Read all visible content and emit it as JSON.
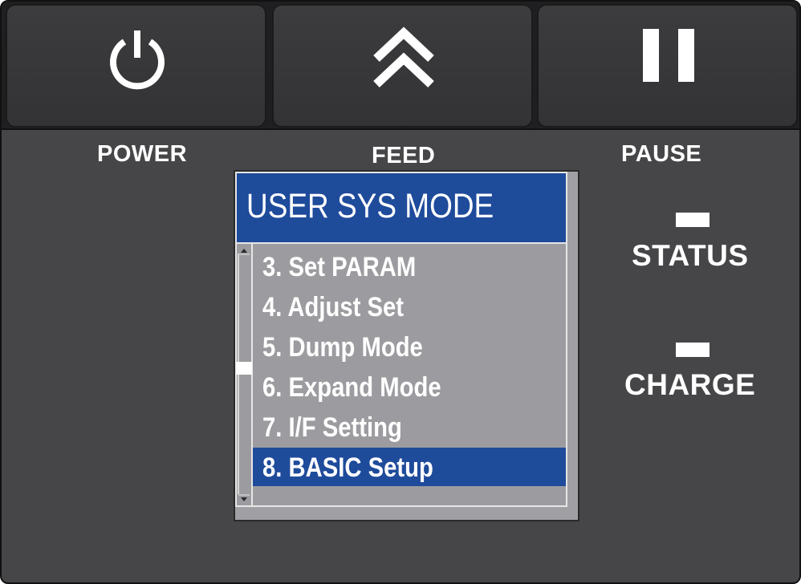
{
  "buttons": {
    "power": {
      "label": "POWER",
      "icon": "power-icon"
    },
    "feed": {
      "label": "FEED",
      "icon": "double-chevron-up-icon"
    },
    "pause": {
      "label": "PAUSE",
      "icon": "pause-icon"
    }
  },
  "lcd": {
    "title": "USER SYS MODE",
    "items": [
      {
        "label": "3. Set PARAM"
      },
      {
        "label": "4. Adjust Set"
      },
      {
        "label": "5. Dump Mode"
      },
      {
        "label": "6. Expand Mode"
      },
      {
        "label": "7. I/F Setting"
      },
      {
        "label": "8. BASIC Setup"
      }
    ],
    "selected_item": "8. BASIC Setup"
  },
  "indicators": {
    "status": {
      "label": "STATUS",
      "color": "#ffffff"
    },
    "charge": {
      "label": "CHARGE",
      "color": "#ffffff"
    }
  },
  "colors": {
    "panel": "#464648",
    "lcd_highlight": "#1f4b9b",
    "lcd_background": "#9c9ca0"
  }
}
